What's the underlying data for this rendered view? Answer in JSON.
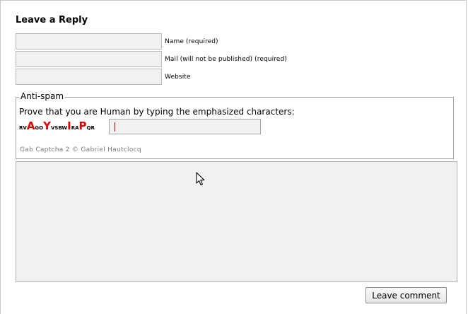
{
  "form": {
    "title": "Leave a Reply",
    "fields": {
      "name_label": "Name (required)",
      "mail_label": "Mail (will not be published) (required)",
      "website_label": "Website"
    },
    "antispam": {
      "legend": "Anti-spam",
      "instruction": "Prove that you are Human by typing the emphasized characters:",
      "captcha_chars": [
        {
          "text": "RV",
          "emphasized": false
        },
        {
          "text": "A",
          "emphasized": true
        },
        {
          "text": "GO",
          "emphasized": false
        },
        {
          "text": "Y",
          "emphasized": true
        },
        {
          "text": "VSBW",
          "emphasized": false
        },
        {
          "text": "I",
          "emphasized": true
        },
        {
          "text": "RA",
          "emphasized": false
        },
        {
          "text": "P",
          "emphasized": true
        },
        {
          "text": "QR",
          "emphasized": false
        }
      ],
      "captcha_value": "",
      "credit": "Gab Captcha 2 © Gabriel Hautclocq"
    },
    "comment_value": "",
    "submit_label": "Leave comment"
  },
  "colors": {
    "emphasis": "#e00000",
    "input_bg": "#f1f1f1",
    "credit_text": "#7a7a7a"
  },
  "icons": {
    "pointer": "mouse-pointer-icon"
  }
}
